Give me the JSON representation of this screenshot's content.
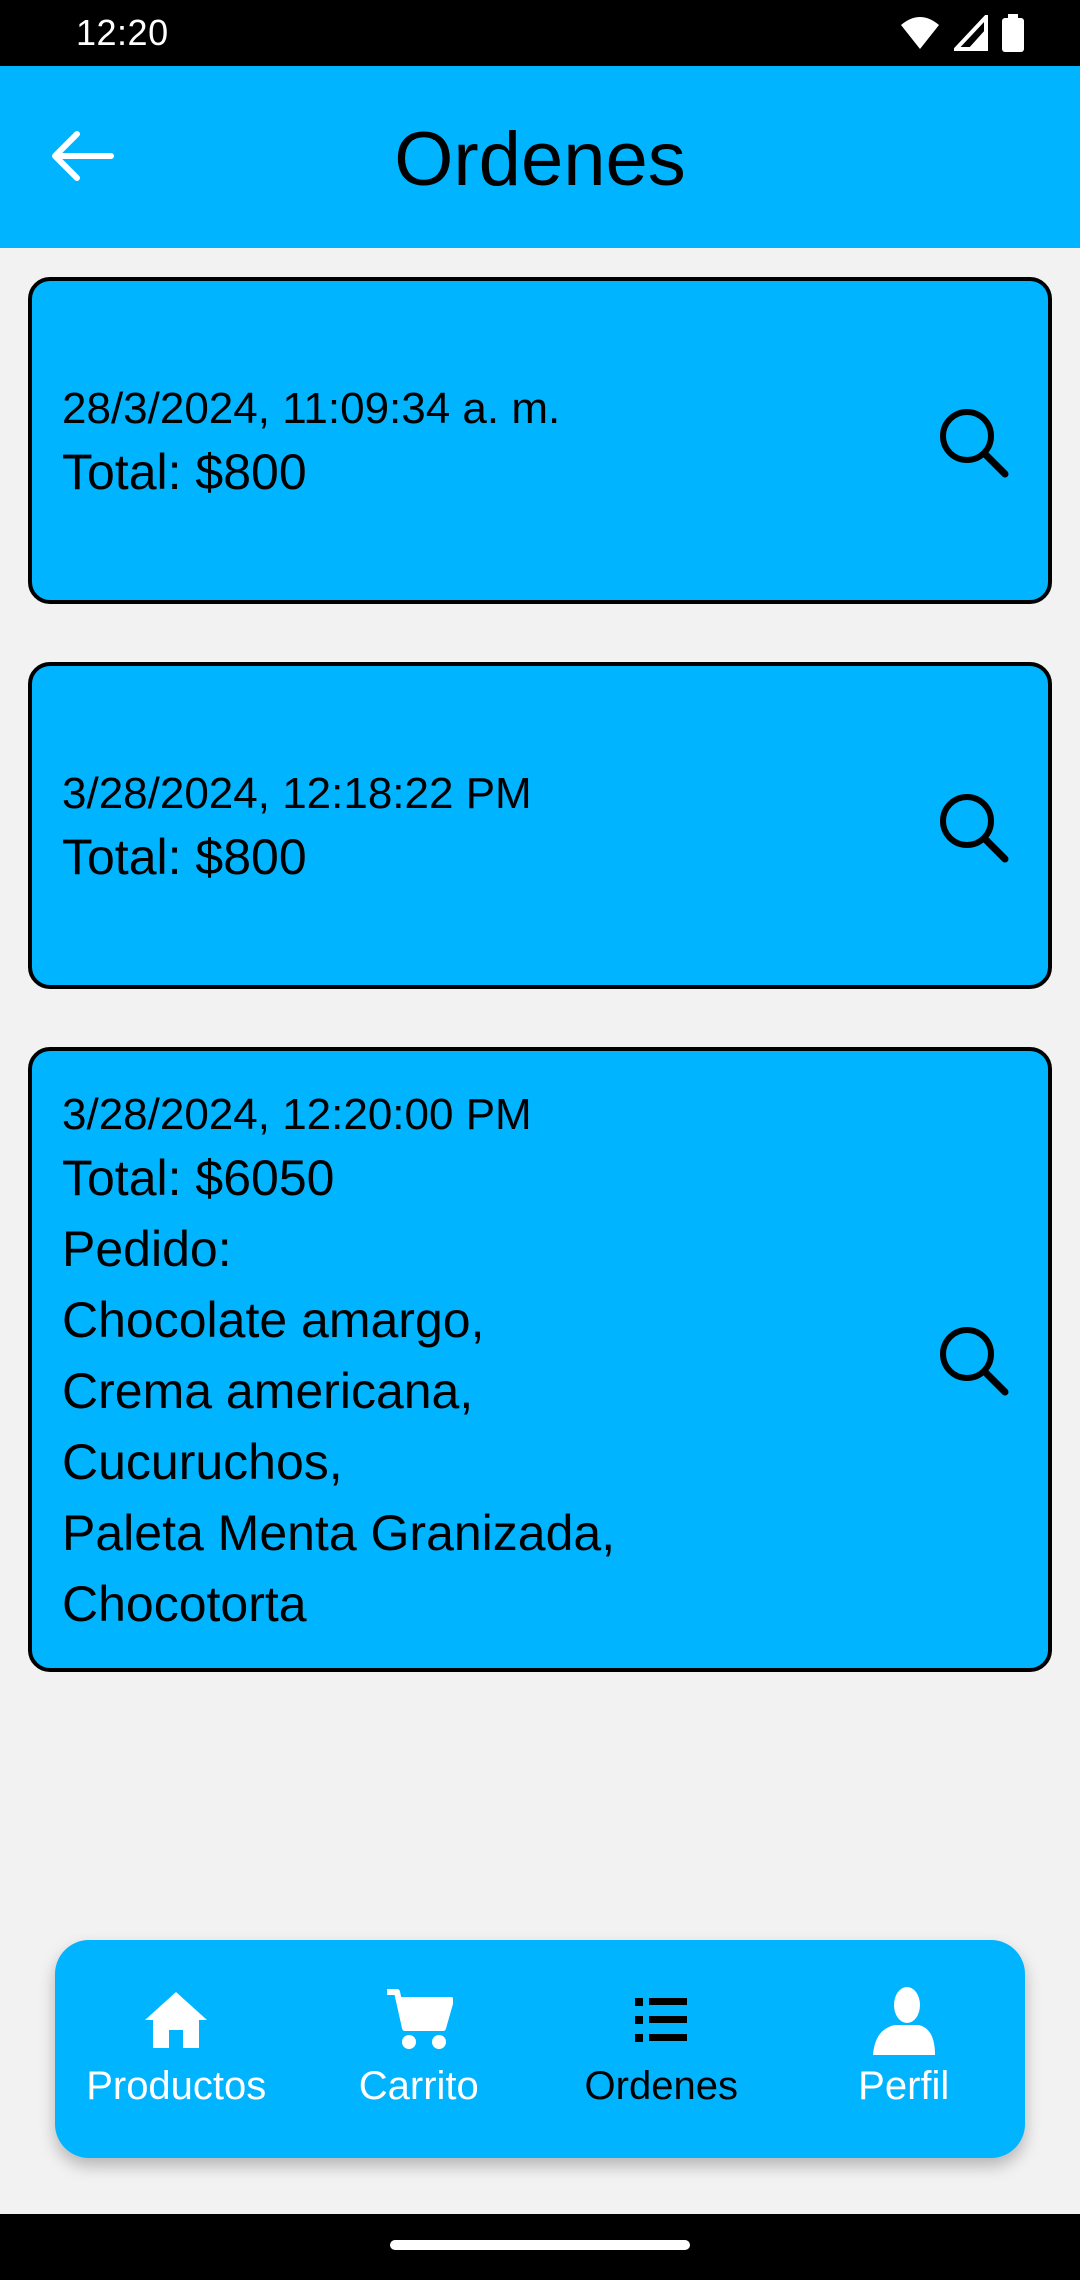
{
  "status_bar": {
    "time": "12:20"
  },
  "app_bar": {
    "title": "Ordenes"
  },
  "orders": [
    {
      "date": "28/3/2024, 11:09:34 a. m.",
      "total": "Total: $800"
    },
    {
      "date": "3/28/2024, 12:18:22 PM",
      "total": "Total: $800"
    },
    {
      "date": "3/28/2024, 12:20:00 PM",
      "total": "Total: $6050",
      "pedido_label": "Pedido:",
      "items": [
        "Chocolate amargo,",
        "Crema americana,",
        "Cucuruchos,",
        "Paleta Menta Granizada,",
        "Chocotorta"
      ]
    }
  ],
  "bottom_nav": {
    "items": [
      {
        "label": "Productos",
        "icon": "home-icon",
        "active": false
      },
      {
        "label": "Carrito",
        "icon": "cart-icon",
        "active": false
      },
      {
        "label": "Ordenes",
        "icon": "list-icon",
        "active": true
      },
      {
        "label": "Perfil",
        "icon": "person-icon",
        "active": false
      }
    ]
  },
  "colors": {
    "accent": "#00b4ff",
    "background": "#f2f2f2",
    "text": "#000000",
    "nav_inactive": "#ffffff"
  }
}
